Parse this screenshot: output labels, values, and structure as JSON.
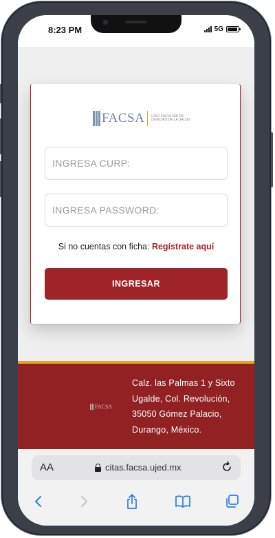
{
  "status_bar": {
    "time": "8:23 PM",
    "network": "5G"
  },
  "logo": {
    "text": "FACSA",
    "subtitle": "UJED FACULTAD DE CIENCIAS DE LA SALUD"
  },
  "form": {
    "curp_placeholder": "INGRESA CURP:",
    "password_placeholder": "INGRESA PASSWORD:",
    "signup_prompt": "Si no cuentas con ficha: ",
    "signup_link": "Regístrate aquí",
    "submit_label": "INGRESAR"
  },
  "footer": {
    "logo_text": "FACSA",
    "address_lines": [
      "Calz. las Palmas 1 y Sixto",
      "Ugalde, Col. Revolución,",
      "35050 Gómez Palacio,",
      "Durango, México."
    ]
  },
  "browser": {
    "text_size_label": "AA",
    "url": "citas.facsa.ujed.mx"
  },
  "colors": {
    "brand_red": "#9e2429",
    "footer_red": "#922124",
    "accent_gold": "#e1a52c",
    "link_blue": "#2b7de9"
  },
  "icons": [
    "lock-icon",
    "reload-icon",
    "back-icon",
    "forward-icon",
    "share-icon",
    "bookmarks-icon",
    "tabs-icon"
  ]
}
